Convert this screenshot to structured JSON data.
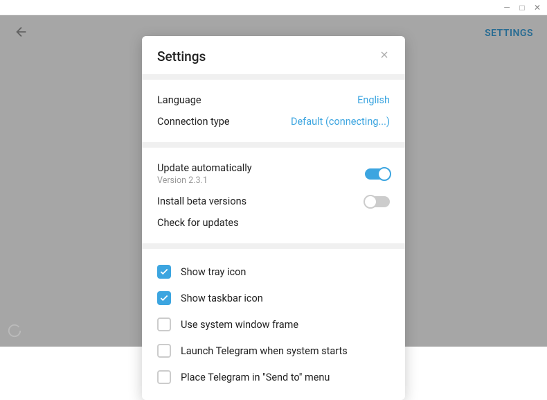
{
  "titlebar": {
    "min": "—",
    "max": "□",
    "close": "✕"
  },
  "header": {
    "settings_link": "SETTINGS"
  },
  "modal": {
    "title": "Settings",
    "language": {
      "label": "Language",
      "value": "English"
    },
    "connection": {
      "label": "Connection type",
      "value": "Default (connecting...)"
    },
    "update_auto": {
      "label": "Update automatically",
      "version": "Version 2.3.1",
      "enabled": true
    },
    "install_beta": {
      "label": "Install beta versions",
      "enabled": false
    },
    "check_updates": {
      "label": "Check for updates"
    },
    "checkboxes": [
      {
        "label": "Show tray icon",
        "checked": true
      },
      {
        "label": "Show taskbar icon",
        "checked": true
      },
      {
        "label": "Use system window frame",
        "checked": false
      },
      {
        "label": "Launch Telegram when system starts",
        "checked": false
      },
      {
        "label": "Place Telegram in \"Send to\" menu",
        "checked": false
      }
    ]
  }
}
